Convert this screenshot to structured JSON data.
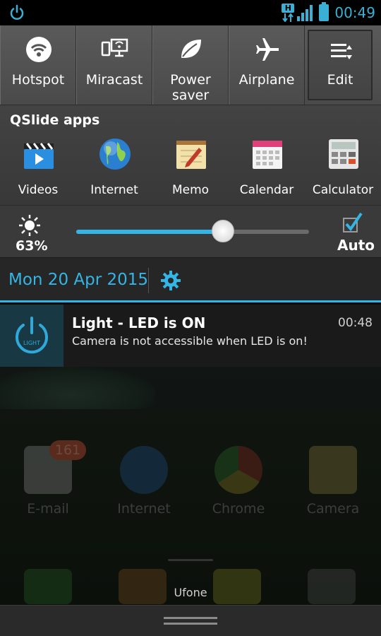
{
  "status_bar": {
    "network_type": "H",
    "time": "00:49"
  },
  "quick_toggles": [
    {
      "label": "Hotspot",
      "icon": "wifi-hotspot-icon"
    },
    {
      "label": "Miracast",
      "icon": "miracast-icon"
    },
    {
      "label": "Power saver",
      "icon": "leaf-icon"
    },
    {
      "label": "Airplane",
      "icon": "airplane-icon"
    },
    {
      "label": "Edit",
      "icon": "edit-list-icon"
    }
  ],
  "qslide": {
    "title": "QSlide apps",
    "apps": [
      {
        "label": "Videos",
        "icon": "clapperboard-icon"
      },
      {
        "label": "Internet",
        "icon": "globe-icon"
      },
      {
        "label": "Memo",
        "icon": "memo-pad-icon"
      },
      {
        "label": "Calendar",
        "icon": "calendar-icon"
      },
      {
        "label": "Calculator",
        "icon": "calculator-icon"
      }
    ]
  },
  "brightness": {
    "percent_label": "63%",
    "level": 0.63,
    "auto_label": "Auto",
    "auto_checked": true
  },
  "date_bar": {
    "date": "Mon 20 Apr 2015"
  },
  "notification": {
    "title": "Light - LED is ON",
    "time": "00:48",
    "text": "Camera is not accessible when LED is on!",
    "icon_text": "LIGHT"
  },
  "home_screen": {
    "apps": [
      {
        "label": "E-mail",
        "badge": "161"
      },
      {
        "label": "Internet"
      },
      {
        "label": "Chrome"
      },
      {
        "label": "Camera"
      }
    ],
    "carrier": "Ufone"
  },
  "colors": {
    "accent": "#33b5e5",
    "panel": "#3a3a3a",
    "status_text": "#3ab0d4"
  }
}
